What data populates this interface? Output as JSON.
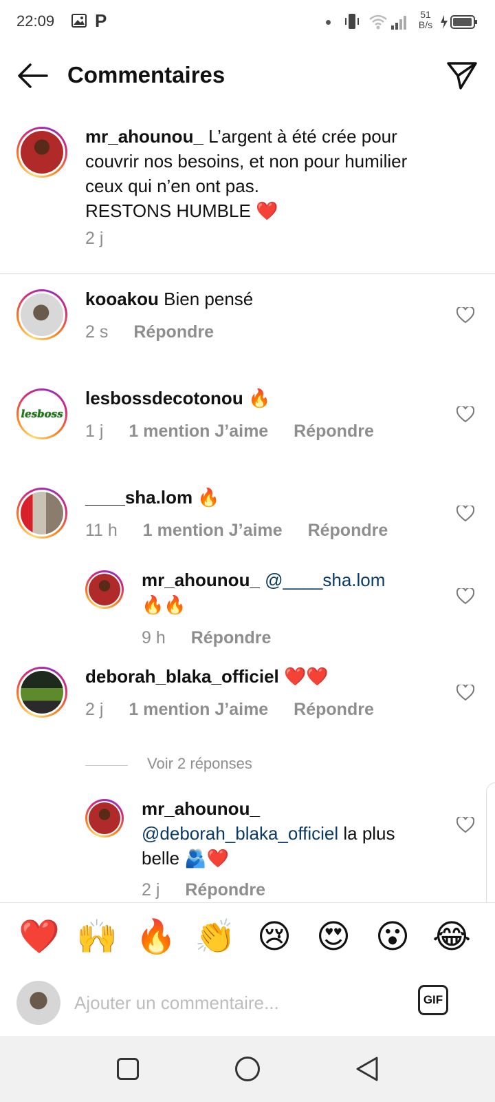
{
  "status_bar": {
    "time": "22:09",
    "p_glyph": "P",
    "net_speed_value": "51",
    "net_speed_unit": "B/s"
  },
  "header": {
    "title": "Commentaires"
  },
  "caption": {
    "username": "mr_ahounou_",
    "text_line1": "L’argent à été crée pour",
    "text_line2": "couvrir nos besoins, et non pour humilier",
    "text_line3": "ceux qui n’en ont pas.",
    "text_line4": "RESTONS HUMBLE",
    "emoji": "❤️",
    "time": "2 j"
  },
  "comments": [
    {
      "username": "kooakou",
      "text": "Bien pensé",
      "time": "2 s",
      "reply_label": "Répondre"
    },
    {
      "username": "lesbossdecotonou",
      "text": "🔥",
      "avatar_text": "lesboss",
      "time": "1 j",
      "likes_label": "1 mention J’aime",
      "reply_label": "Répondre"
    },
    {
      "username": "____sha.lom",
      "text": "🔥",
      "time": "11 h",
      "likes_label": "1 mention J’aime",
      "reply_label": "Répondre"
    },
    {
      "username": "mr_ahounou_",
      "mention": "@____sha.lom",
      "text": "🔥🔥",
      "time": "9 h",
      "reply_label": "Répondre"
    },
    {
      "username": "deborah_blaka_officiel",
      "text": "❤️❤️",
      "time": "2 j",
      "likes_label": "1 mention J’aime",
      "reply_label": "Répondre"
    },
    {
      "username": "mr_ahounou_",
      "mention": "@deborah_blaka_officiel",
      "text_after": "la plus",
      "text_line2": "belle 🫂❤️",
      "time": "2 j",
      "reply_label": "Répondre"
    }
  ],
  "view_replies_label": "Voir 2 réponses",
  "emoji_bar": [
    "❤️",
    "🙌",
    "🔥",
    "👏",
    "😢",
    "😍",
    "😮",
    "😂"
  ],
  "input": {
    "placeholder": "Ajouter un commentaire...",
    "gif_label": "GIF"
  },
  "icons": {
    "back": "arrow-left-icon",
    "send": "paper-plane-icon",
    "heart": "heart-outline-icon",
    "nav_recent": "square-icon",
    "nav_home": "circle-icon",
    "nav_back": "triangle-back-icon"
  },
  "colors": {
    "mention": "#0b3a66",
    "meta_grey": "#8e8e8e",
    "story_ring_start": "#feda75",
    "story_ring_end": "#d62976"
  }
}
